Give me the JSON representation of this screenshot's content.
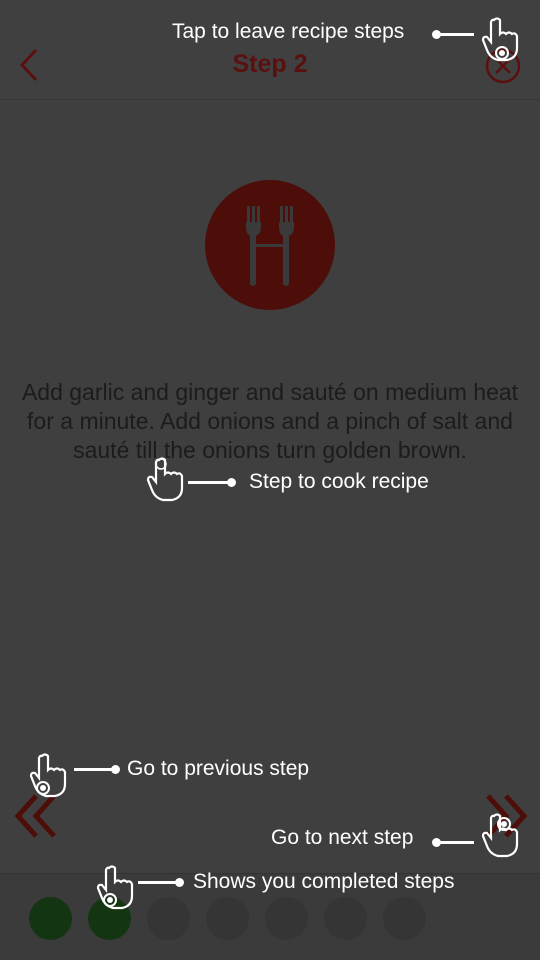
{
  "header": {
    "title": "Step 2",
    "back_icon": "chevron-left-icon",
    "close_icon": "close-circle-icon"
  },
  "step": {
    "icon": "fork-and-fork-icon",
    "instruction": "Add garlic and ginger and sauté on medium heat for a minute. Add onions and a pinch of salt and sauté till the onions turn golden brown."
  },
  "nav": {
    "prev_icon": "double-chevron-left-icon",
    "next_icon": "double-chevron-right-icon"
  },
  "progress": {
    "total_steps": 7,
    "completed_steps": 2
  },
  "coach_marks": {
    "leave": "Tap to leave recipe steps",
    "cook": "Step to cook recipe",
    "previous": "Go to previous step",
    "next": "Go to next step",
    "completed": "Shows you completed steps"
  },
  "colors": {
    "accent": "#5b1010",
    "completed_dot": "#143511",
    "pending_dot": "#353535",
    "overlay_text": "#ffffff"
  }
}
